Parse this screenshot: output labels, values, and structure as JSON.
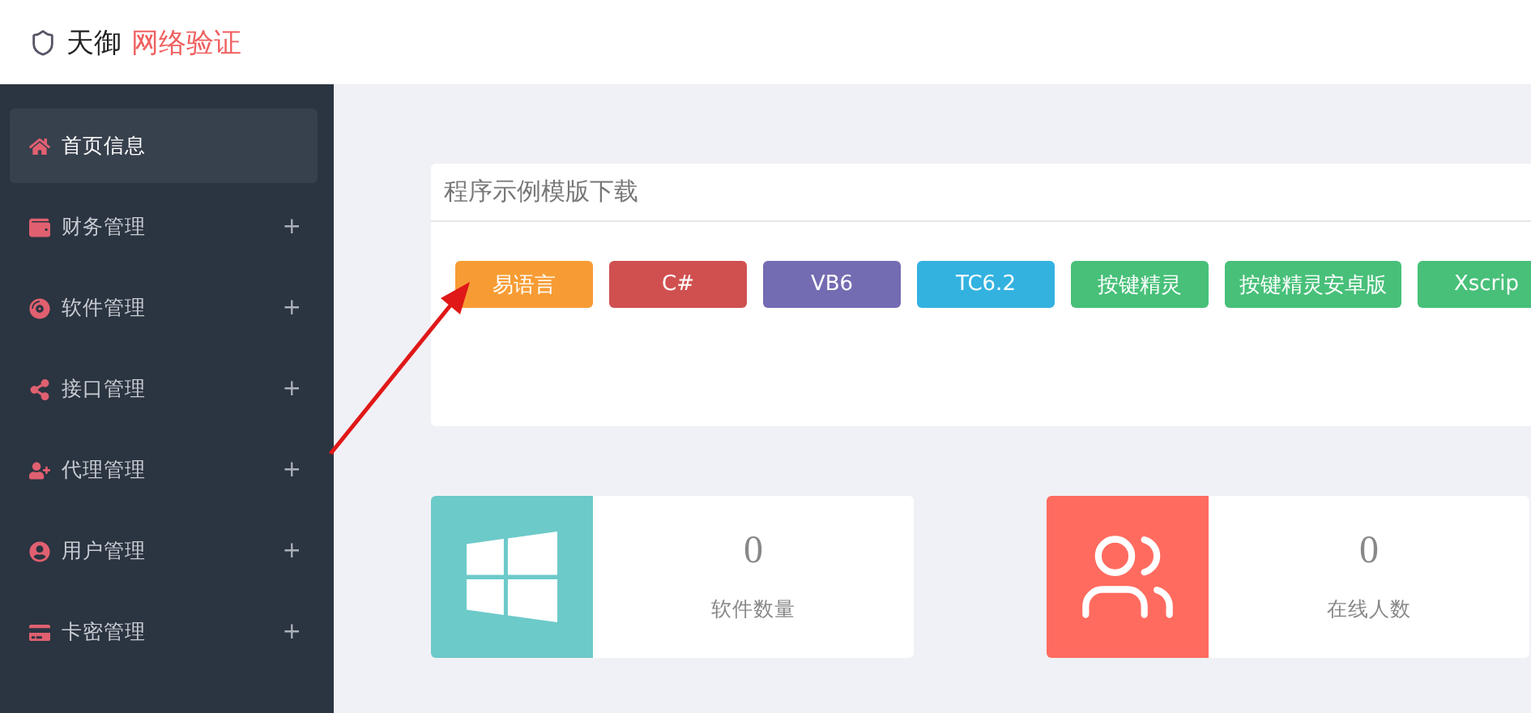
{
  "header": {
    "brand": "天御",
    "subtitle": "网络验证"
  },
  "sidebar": {
    "items": [
      {
        "label": "首页信息",
        "selected": true,
        "kind": "home"
      },
      {
        "label": "财务管理",
        "selected": false,
        "kind": "wallet",
        "toggle": "+"
      },
      {
        "label": "软件管理",
        "selected": false,
        "kind": "software",
        "toggle": "+"
      },
      {
        "label": "接口管理",
        "selected": false,
        "kind": "share",
        "toggle": "+"
      },
      {
        "label": "代理管理",
        "selected": false,
        "kind": "agent",
        "toggle": "+"
      },
      {
        "label": "用户管理",
        "selected": false,
        "kind": "user",
        "toggle": "+"
      },
      {
        "label": "卡密管理",
        "selected": false,
        "kind": "card",
        "toggle": "+"
      }
    ]
  },
  "downloads": {
    "title": "程序示例模版下载",
    "buttons": [
      {
        "label": "易语言",
        "color": "#f79c34"
      },
      {
        "label": "C#",
        "color": "#d05050"
      },
      {
        "label": "VB6",
        "color": "#736cb2"
      },
      {
        "label": "TC6.2",
        "color": "#33b2e0"
      },
      {
        "label": "按键精灵",
        "color": "#48c079"
      },
      {
        "label": "按键精灵安卓版",
        "color": "#48c079"
      },
      {
        "label": "Xscrip",
        "color": "#48c079"
      }
    ]
  },
  "stats": [
    {
      "value": "0",
      "label": "软件数量",
      "color": "#6ccac9",
      "kind": "windows"
    },
    {
      "value": "0",
      "label": "在线人数",
      "color": "#ff6b5f",
      "kind": "people"
    }
  ],
  "annotation": {
    "kind": "arrow"
  }
}
